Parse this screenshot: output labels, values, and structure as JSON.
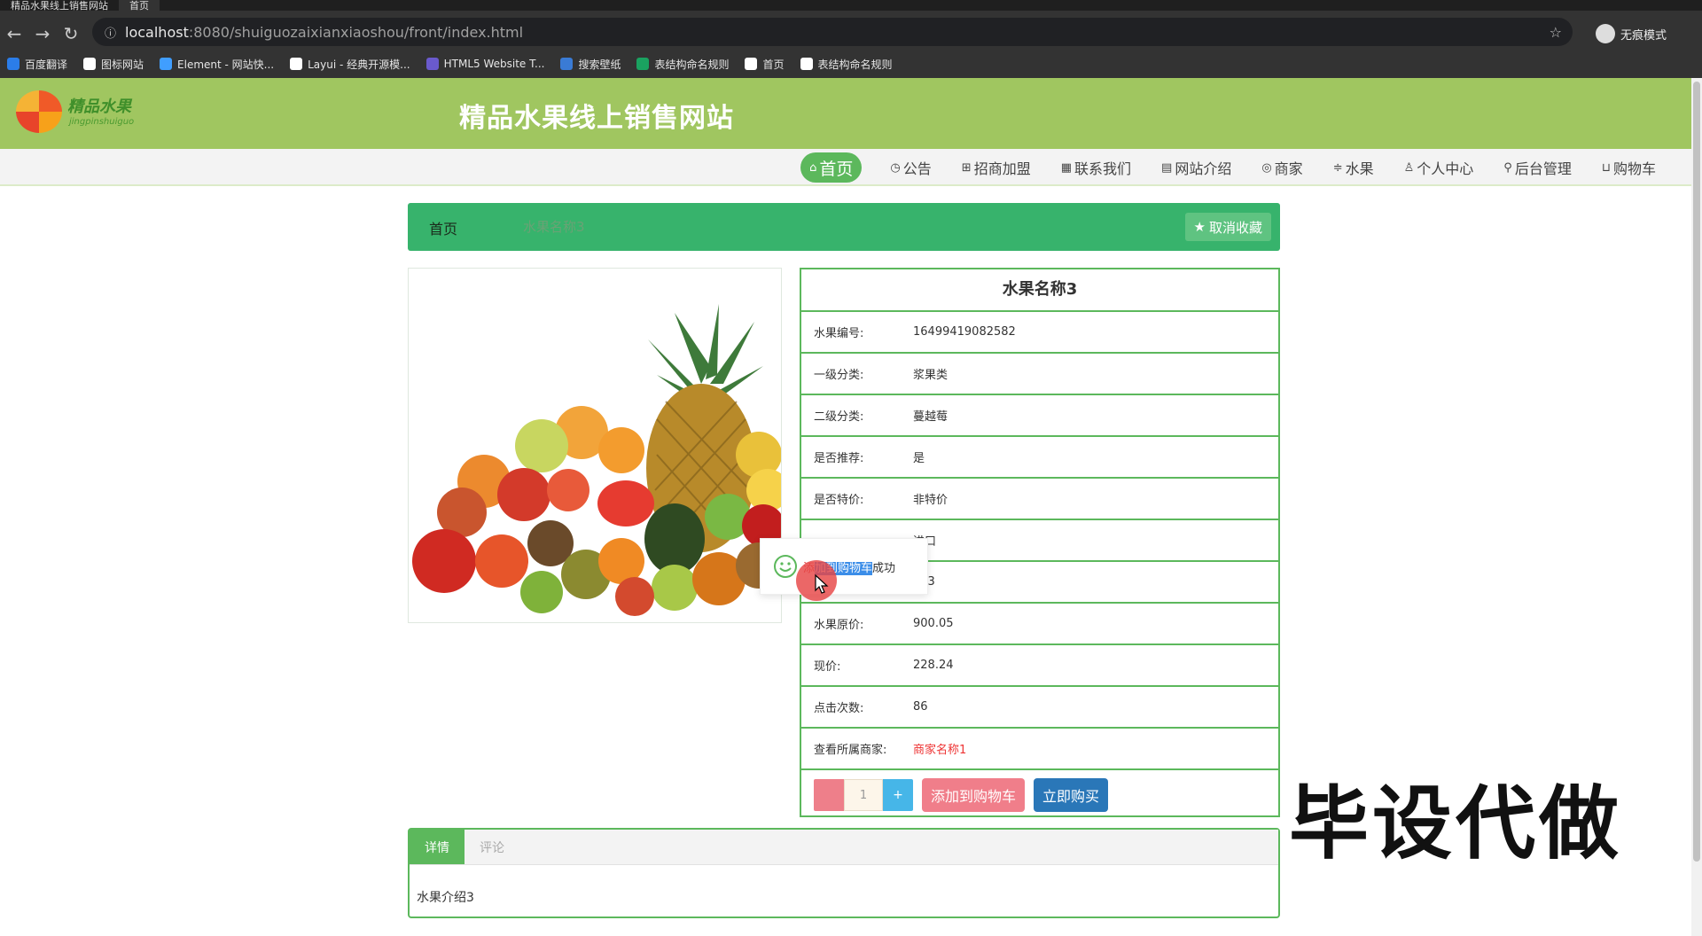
{
  "browser": {
    "tabs": [
      {
        "label": "精品水果线上销售网站",
        "active": false
      },
      {
        "label": "首页",
        "active": true
      }
    ],
    "url_host": "localhost",
    "url_path": ":8080/shuiguozaixianxiaoshou/front/index.html",
    "profile_label": "无痕模式",
    "bookmarks": [
      {
        "label": "百度翻译",
        "color": "#2b7de9"
      },
      {
        "label": "图标网站",
        "color": "#ffffff"
      },
      {
        "label": "Element - 网站快...",
        "color": "#409eff"
      },
      {
        "label": "Layui - 经典开源模...",
        "color": "#ffffff"
      },
      {
        "label": "HTML5 Website T...",
        "color": "#6a5acd"
      },
      {
        "label": "搜索壁纸",
        "color": "#3a7bd5"
      },
      {
        "label": "表结构命名规则",
        "color": "#1aa260"
      },
      {
        "label": "首页",
        "color": "#ffffff"
      },
      {
        "label": "表结构命名规则",
        "color": "#ffffff"
      }
    ]
  },
  "site": {
    "logo_text": "精品水果",
    "logo_sub": "jingpinshuiguo",
    "title": "精品水果线上销售网站",
    "nav": [
      {
        "icon": "home-icon",
        "glyph": "⌂",
        "label": "首页",
        "active": true
      },
      {
        "icon": "notice-icon",
        "glyph": "◷",
        "label": "公告",
        "active": false
      },
      {
        "icon": "grid-icon",
        "glyph": "⊞",
        "label": "招商加盟",
        "active": false
      },
      {
        "icon": "contact-icon",
        "glyph": "▦",
        "label": "联系我们",
        "active": false
      },
      {
        "icon": "apps-icon",
        "glyph": "▤",
        "label": "网站介绍",
        "active": false
      },
      {
        "icon": "shop-icon",
        "glyph": "◎",
        "label": "商家",
        "active": false
      },
      {
        "icon": "filter-icon",
        "glyph": "≑",
        "label": "水果",
        "active": false
      },
      {
        "icon": "user-icon",
        "glyph": "♙",
        "label": "个人中心",
        "active": false
      },
      {
        "icon": "link-icon",
        "glyph": "⚲",
        "label": "后台管理",
        "active": false
      },
      {
        "icon": "cart-icon",
        "glyph": "⊔",
        "label": "购物车",
        "active": false
      }
    ]
  },
  "breadcrumb": {
    "home": "首页",
    "current": "水果名称3",
    "fav_label": "取消收藏"
  },
  "product": {
    "name": "水果名称3",
    "fields": [
      {
        "label": "水果编号:",
        "value": "16499419082582"
      },
      {
        "label": "一级分类:",
        "value": "浆果类"
      },
      {
        "label": "二级分类:",
        "value": "蔓越莓"
      },
      {
        "label": "是否推荐:",
        "value": "是"
      },
      {
        "label": "是否特价:",
        "value": "非特价"
      },
      {
        "label": "",
        "value": "进口"
      },
      {
        "label": "",
        "value": "103"
      },
      {
        "label": "水果原价:",
        "value": "900.05"
      },
      {
        "label": "现价:",
        "value": "228.24"
      },
      {
        "label": "点击次数:",
        "value": "86"
      },
      {
        "label": "查看所属商家:",
        "value": "商家名称1",
        "link": true
      }
    ],
    "quantity": "1",
    "plus": "+",
    "add_cart_label": "添加到购物车",
    "buy_now_label": "立即购买"
  },
  "toast": {
    "pre": "添",
    "highlight": "加到购物车",
    "post": "成功"
  },
  "watermark": "毕设代做",
  "tabs": {
    "items": [
      {
        "label": "详情",
        "active": true
      },
      {
        "label": "评论",
        "active": false
      }
    ],
    "content": "水果介绍3"
  }
}
